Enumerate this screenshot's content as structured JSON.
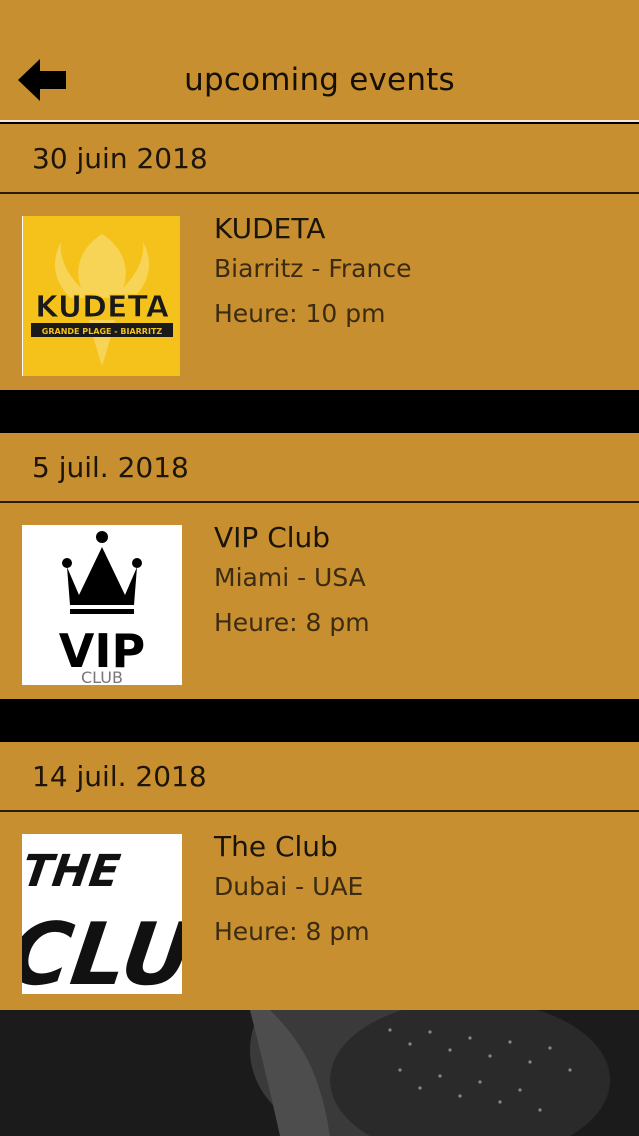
{
  "header": {
    "title": "upcoming events",
    "back_icon": "arrow-left-icon"
  },
  "colors": {
    "bar": "#c78f2f",
    "separator": "#000000",
    "header_underline": "#f1ead9"
  },
  "events": [
    {
      "date": "30 juin 2018",
      "name": "KUDETA",
      "location": "Biarritz - France",
      "time": "Heure: 10 pm",
      "logo_icon": "kudeta-logo",
      "logo_text": "KUDETA",
      "logo_subtext": "GRANDE PLAGE - BIARRITZ"
    },
    {
      "date": "5 juil. 2018",
      "name": "VIP Club",
      "location": "Miami - USA",
      "time": "Heure: 8 pm",
      "logo_icon": "vip-club-logo",
      "logo_text": "VIP",
      "logo_subtext": "CLUB"
    },
    {
      "date": "14 juil. 2018",
      "name": "The Club",
      "location": "Dubai - UAE",
      "time": "Heure: 8 pm",
      "logo_icon": "the-club-logo",
      "logo_text": "THE",
      "logo_subtext": "CLU"
    }
  ]
}
